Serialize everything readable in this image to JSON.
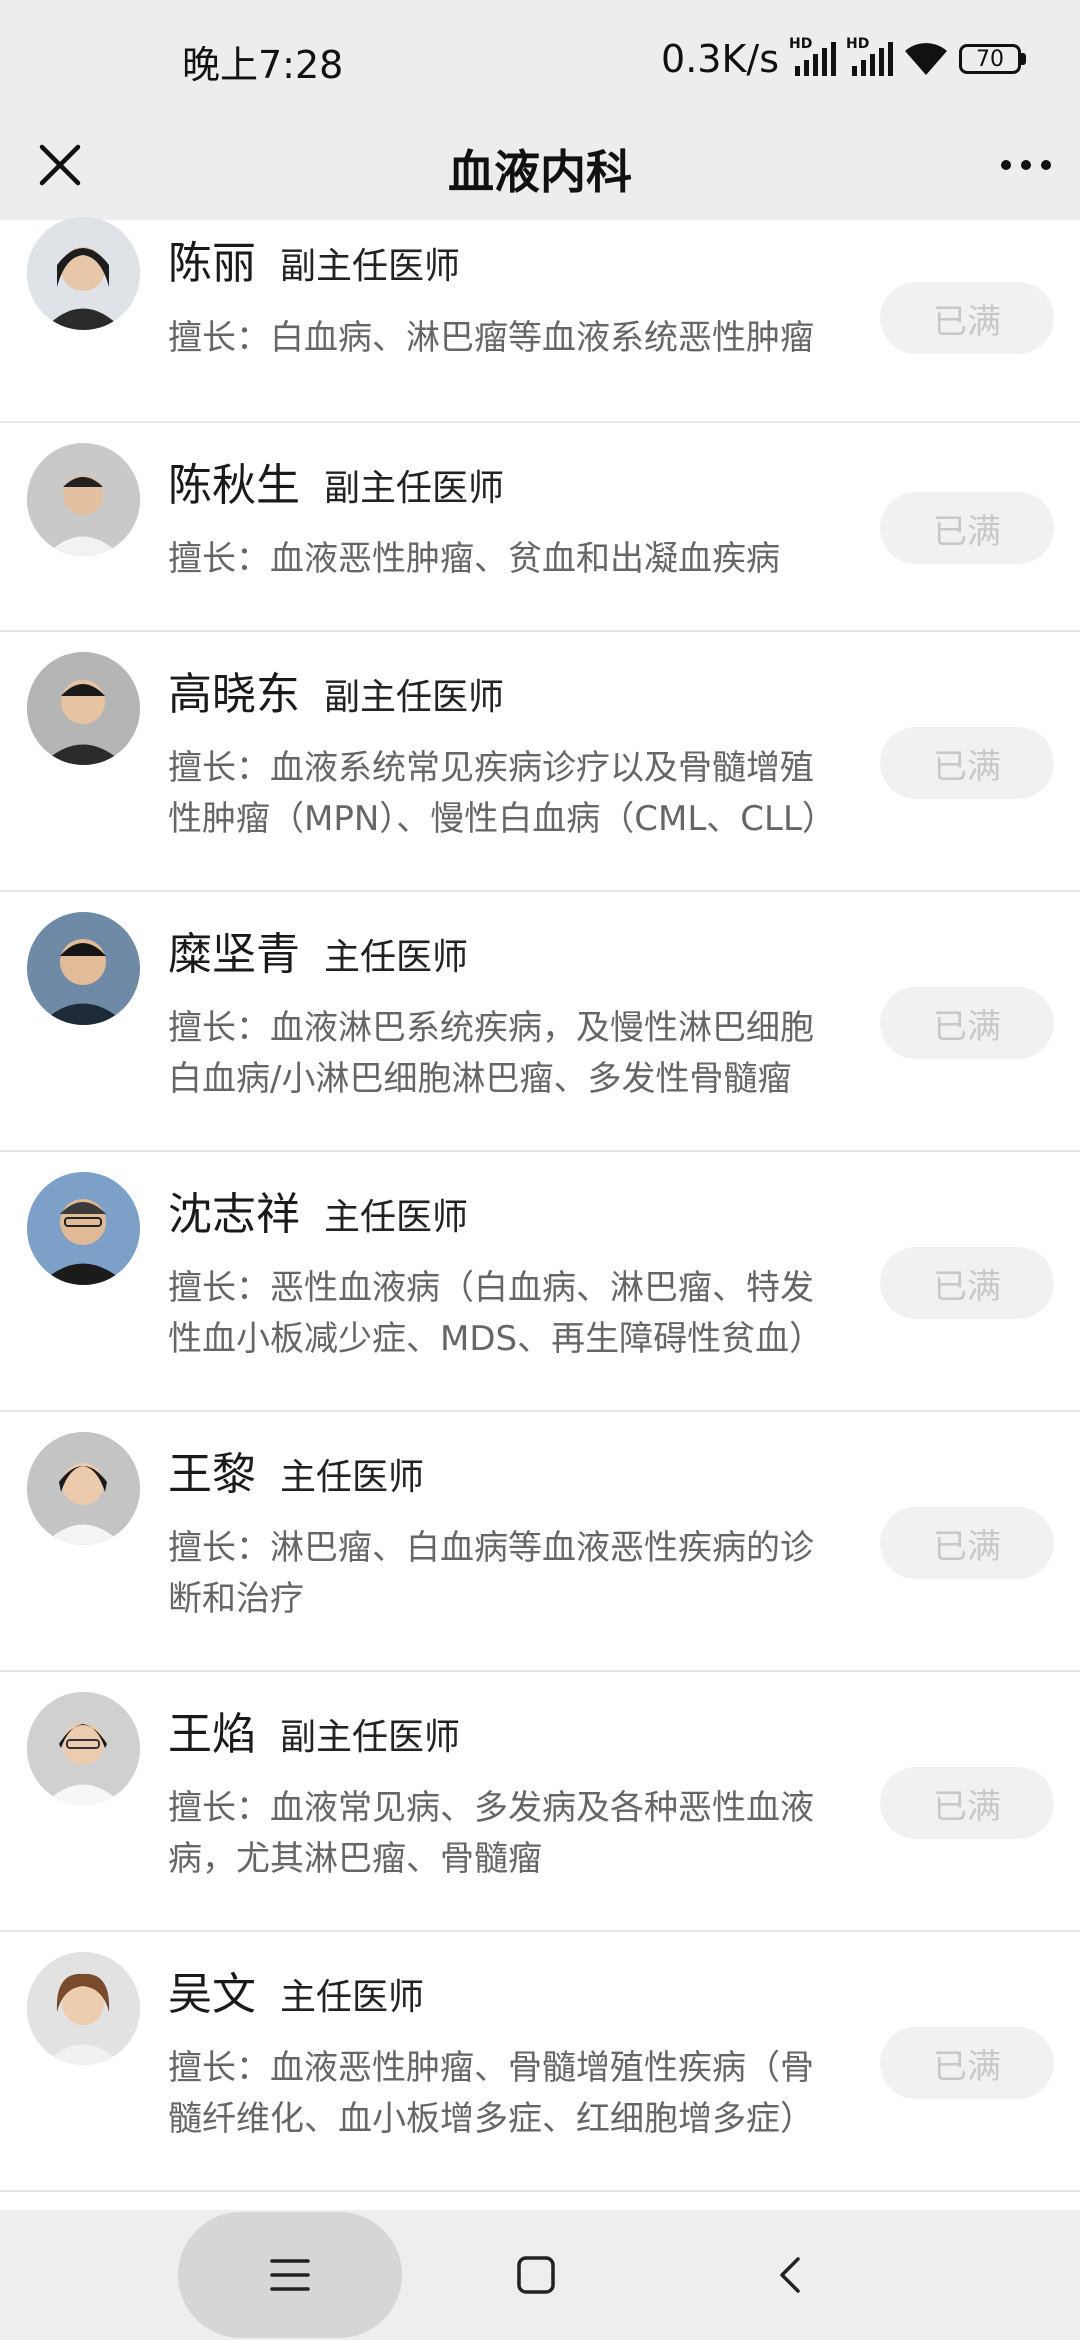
{
  "status_bar": {
    "time": "晚上7:28",
    "net_speed": "0.3K/s",
    "battery": "70"
  },
  "header": {
    "title": "血液内科"
  },
  "doctors": [
    {
      "name": "陈丽",
      "title": "副主任医师",
      "specialty": "擅长：白血病、淋巴瘤等血液系统恶性肿瘤",
      "status": "已满",
      "avatar_color": "#cfd3d8"
    },
    {
      "name": "陈秋生",
      "title": "副主任医师",
      "specialty": "擅长：血液恶性肿瘤、贫血和出凝血疾病",
      "status": "已满",
      "avatar_color": "#c9c9c9"
    },
    {
      "name": "高晓东",
      "title": "副主任医师",
      "specialty": "擅长：血液系统常见疾病诊疗以及骨髓增殖性肿瘤（MPN）、慢性白血病（CML、CLL）",
      "status": "已满",
      "avatar_color": "#b8b8b8"
    },
    {
      "name": "糜坚青",
      "title": "主任医师",
      "specialty": "擅长：血液淋巴系统疾病，及慢性淋巴细胞白血病/小淋巴细胞淋巴瘤、多发性骨髓瘤",
      "status": "已满",
      "avatar_color": "#6f8aa6"
    },
    {
      "name": "沈志祥",
      "title": "主任医师",
      "specialty": "擅长：恶性血液病（白血病、淋巴瘤、特发性血小板减少症、MDS、再生障碍性贫血）",
      "status": "已满",
      "avatar_color": "#7da0c9"
    },
    {
      "name": "王黎",
      "title": "主任医师",
      "specialty": "擅长：淋巴瘤、白血病等血液恶性疾病的诊断和治疗",
      "status": "已满",
      "avatar_color": "#c4c4c4"
    },
    {
      "name": "王焰",
      "title": "副主任医师",
      "specialty": "擅长：血液常见病、多发病及各种恶性血液病，尤其淋巴瘤、骨髓瘤",
      "status": "已满",
      "avatar_color": "#d0d0d0"
    },
    {
      "name": "吴文",
      "title": "主任医师",
      "specialty": "擅长：血液恶性肿瘤、骨髓增殖性疾病（骨髓纤维化、血小板增多症、红细胞增多症）",
      "status": "已满",
      "avatar_color": "#d9d9d9"
    }
  ]
}
